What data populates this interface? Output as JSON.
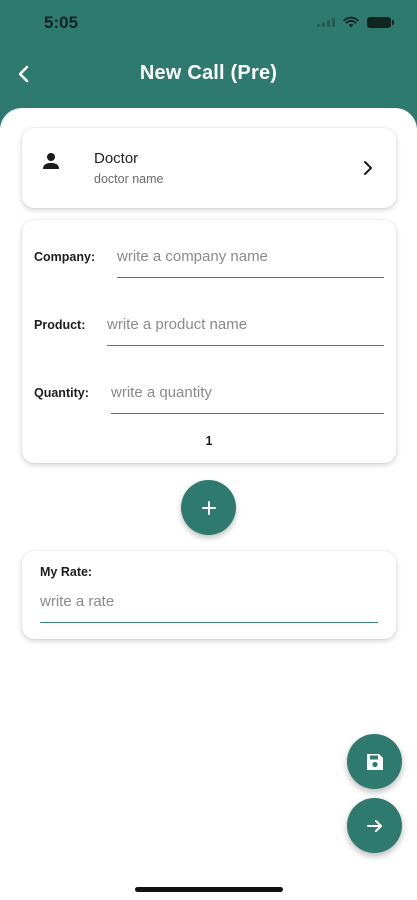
{
  "status_bar": {
    "time": "5:05"
  },
  "app_bar": {
    "title": "New Call (Pre)",
    "back_icon": "chevron-left-icon"
  },
  "doctor": {
    "title": "Doctor",
    "subtitle": "doctor name",
    "icon": "person-icon",
    "chevron_icon": "chevron-right-icon"
  },
  "product_form": {
    "company_label": "Company:",
    "company_placeholder": "write a company name",
    "product_label": "Product:",
    "product_placeholder": "write a product name",
    "quantity_label": "Quantity:",
    "quantity_placeholder": "write a quantity",
    "item_index": "1"
  },
  "add_button": {
    "icon": "plus-icon"
  },
  "rate": {
    "label": "My Rate:",
    "placeholder": "write a rate"
  },
  "fabs": {
    "save_icon": "save-icon",
    "next_icon": "arrow-right-icon"
  },
  "colors": {
    "primary": "#2f7a6f",
    "surface": "#ffffff",
    "underline": "#3a8478"
  }
}
